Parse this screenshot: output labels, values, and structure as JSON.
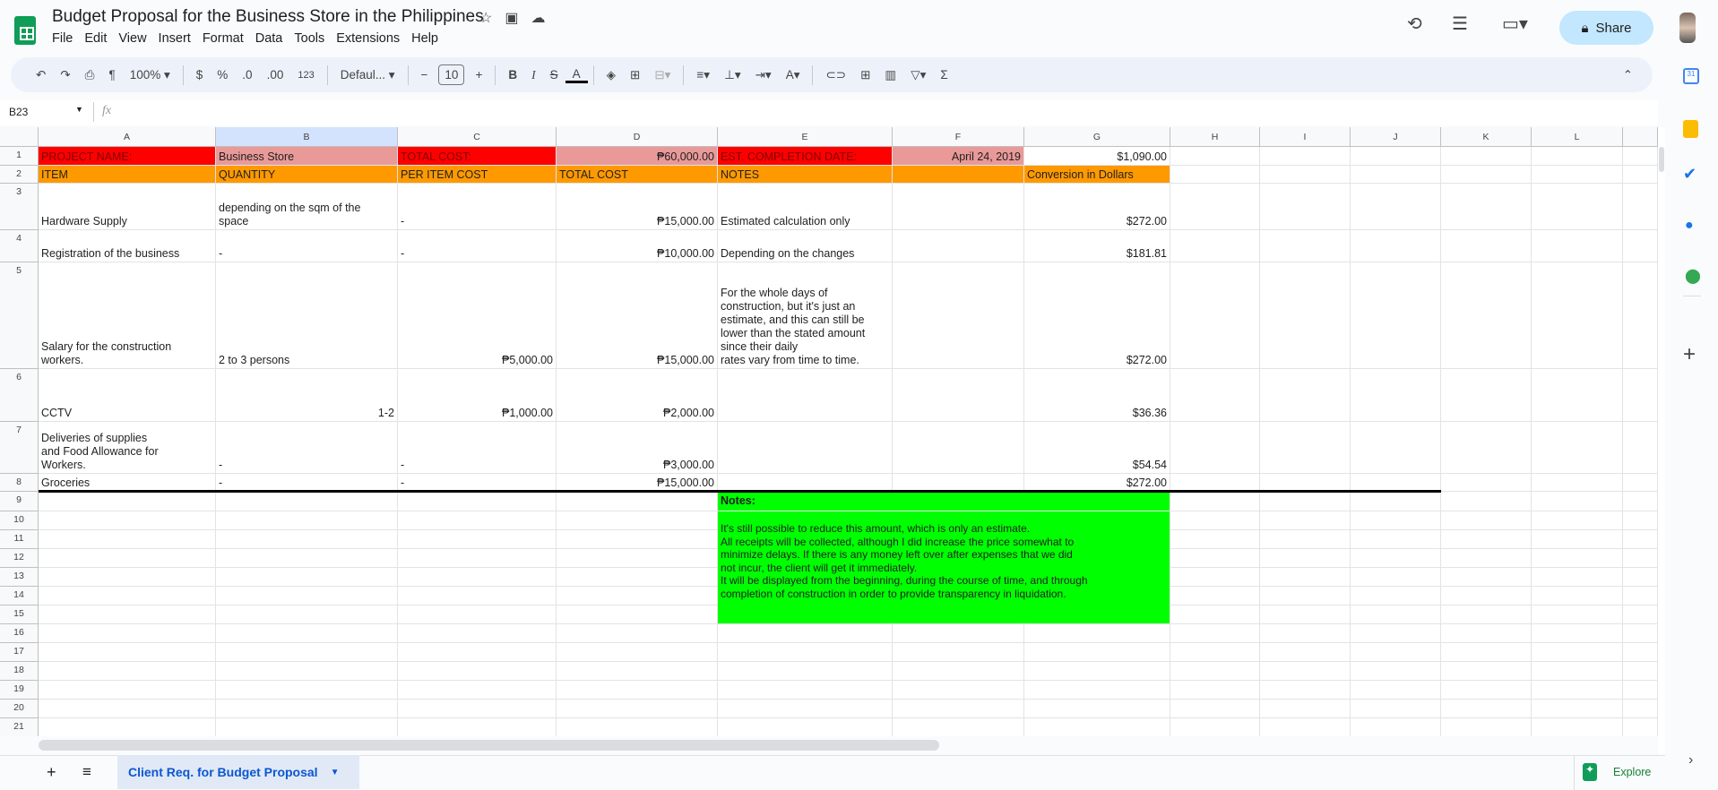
{
  "app": {
    "title": "Budget Proposal for the Business Store in the Philippines",
    "share_label": "Share"
  },
  "menu": [
    "File",
    "Edit",
    "View",
    "Insert",
    "Format",
    "Data",
    "Tools",
    "Extensions",
    "Help"
  ],
  "toolbar": {
    "zoom": "100%",
    "currency": "$",
    "percent": "%",
    "dec_decrease": ".0",
    "dec_increase": ".00",
    "number_format": "123",
    "font": "Defaul...",
    "font_size": "10",
    "bold": "B",
    "italic": "I"
  },
  "formula_bar": {
    "cell_ref": "B23",
    "fx": "fx",
    "value": ""
  },
  "columns": [
    "A",
    "B",
    "C",
    "D",
    "E",
    "F",
    "G",
    "H",
    "I",
    "J",
    "K",
    "L"
  ],
  "row_numbers": [
    "1",
    "2",
    "3",
    "4",
    "5",
    "6",
    "7",
    "8",
    "9",
    "10",
    "11",
    "12",
    "13",
    "14",
    "15",
    "16",
    "17",
    "18",
    "19",
    "20",
    "21"
  ],
  "grid": {
    "rows": [
      [
        "PROJECT NAME:",
        "Business Store",
        "TOTAL COST:",
        "₱60,000.00",
        "EST. COMPLETION DATE:",
        "April 24, 2019",
        "$1,090.00"
      ],
      [
        "ITEM",
        "QUANTITY",
        "PER ITEM COST",
        "TOTAL COST",
        "NOTES",
        "",
        "Conversion in Dollars"
      ],
      [
        "Hardware Supply",
        "depending on the sqm of the\nspace",
        "-",
        "₱15,000.00",
        "Estimated calculation only",
        "",
        "$272.00"
      ],
      [
        "Registration of the business",
        "-",
        "-",
        "₱10,000.00",
        "Depending on the changes",
        "",
        "$181.81"
      ],
      [
        "Salary for the construction\nworkers.",
        "2 to 3 persons",
        "₱5,000.00",
        "₱15,000.00",
        "For the whole days of\nconstruction, but it's just an\nestimate, and this can still be\nlower than the stated amount\nsince their daily\nrates vary from time to time.",
        "",
        "$272.00"
      ],
      [
        "CCTV",
        "1-2",
        "₱1,000.00",
        "₱2,000.00",
        "",
        "",
        "$36.36"
      ],
      [
        "Deliveries of supplies\nand Food Allowance for\nWorkers.",
        "-",
        "-",
        "₱3,000.00",
        "",
        "",
        "$54.54"
      ],
      [
        "Groceries",
        "-",
        "-",
        "₱15,000.00",
        "",
        "",
        "$272.00"
      ]
    ]
  },
  "notes": {
    "title": "Notes:",
    "body": "It's still possible to reduce this amount, which is only an estimate.\nAll receipts will be collected, although I did increase the price somewhat to\nminimize delays. If there is any money left over after expenses that we did\nnot incur, the client will get it immediately.\nIt will be displayed from the beginning, during the course of time, and through\ncompletion of construction in order to provide transparency in liquidation."
  },
  "sheet_tab": {
    "label": "Client Req. for Budget Proposal"
  },
  "explore": {
    "label": "Explore"
  },
  "colors": {
    "red": "#ff0000",
    "pink": "#ea9999",
    "orange": "#ff9900",
    "green": "#00ff00",
    "share": "#c2e7ff"
  }
}
